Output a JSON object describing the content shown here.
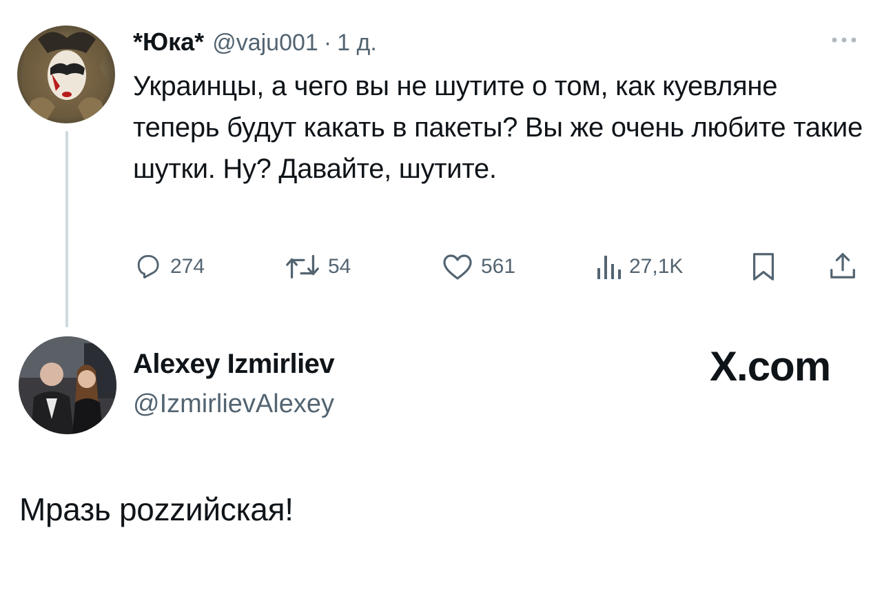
{
  "original_tweet": {
    "author_name": "*Юка*",
    "handle": "@vaju001",
    "separator": "·",
    "time": "1 д.",
    "more_icon": "more-dots-icon",
    "text": "Украинцы, а чего вы не шутите о том, как куевляне теперь будут какать в пакеты? Вы же очень любите такие шутки. Ну?  Давайте, шутите.",
    "actions": {
      "replies": "274",
      "reposts": "54",
      "likes": "561",
      "views": "27,1K"
    }
  },
  "reply": {
    "author_name": "Alexey Izmirliev",
    "handle": "@IzmirlievAlexey",
    "site": "X.com",
    "text": "Мразь pozzийская!"
  },
  "colors": {
    "text": "#0f1419",
    "muted": "#536471",
    "thread_line": "#cfd9de",
    "background": "#ffffff"
  }
}
